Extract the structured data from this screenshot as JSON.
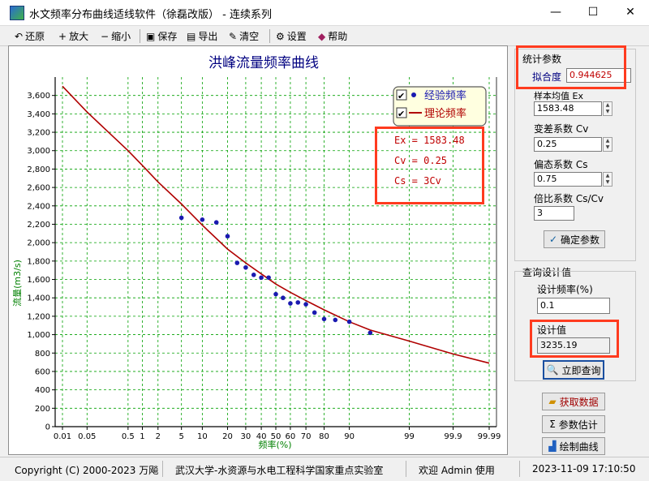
{
  "window": {
    "title": "水文频率分布曲线适线软件（徐磊改版） - 连续系列",
    "minimize": "—",
    "maximize": "☐",
    "close": "✕"
  },
  "toolbar": {
    "restore": {
      "glyph": "↶",
      "label": "还原"
    },
    "zoom_in": {
      "glyph": "+",
      "label": "放大"
    },
    "zoom_out": {
      "glyph": "−",
      "label": "缩小"
    },
    "save": {
      "glyph": "▣",
      "label": "保存"
    },
    "export": {
      "glyph": "▤",
      "label": "导出"
    },
    "clear": {
      "glyph": "✎",
      "label": "清空"
    },
    "settings": {
      "glyph": "⚙",
      "label": "设置"
    },
    "help": {
      "glyph": "◆",
      "label": "帮助"
    }
  },
  "chart_data": {
    "type": "scatter",
    "title": "洪峰流量频率曲线",
    "xlabel": "频率(%)",
    "ylabel": "流量(m3/s)",
    "x_scale": "probability",
    "x_ticks": [
      0.01,
      0.05,
      0.5,
      1,
      2,
      5,
      10,
      20,
      30,
      40,
      50,
      60,
      70,
      80,
      90,
      99,
      99.9,
      99.99
    ],
    "x_tick_labels": [
      "0.01",
      "0.05",
      "0.5",
      "1",
      "2",
      "5",
      "10",
      "20",
      "30",
      "40",
      "50",
      "60",
      "70",
      "80",
      "90",
      "99",
      "99.9",
      "99.99"
    ],
    "ylim": [
      0,
      3800
    ],
    "y_ticks": [
      0,
      200,
      400,
      600,
      800,
      1000,
      1200,
      1400,
      1600,
      1800,
      2000,
      2200,
      2400,
      2600,
      2800,
      3000,
      3200,
      3400,
      3600
    ],
    "y_tick_labels": [
      "0",
      "200",
      "400",
      "600",
      "800",
      "1,000",
      "1,200",
      "1,400",
      "1,600",
      "1,800",
      "2,000",
      "2,200",
      "2,400",
      "2,600",
      "2,800",
      "3,000",
      "3,200",
      "3,400",
      "3,600"
    ],
    "grid": true,
    "series": [
      {
        "name": "经验频率",
        "kind": "points",
        "color": "#1a1ab0",
        "x": [
          5,
          10,
          15,
          20,
          25,
          30,
          35,
          40,
          45,
          50,
          55,
          60,
          65,
          70,
          75,
          80,
          85,
          90,
          95
        ],
        "y": [
          2270,
          2250,
          2220,
          2070,
          1780,
          1730,
          1650,
          1620,
          1620,
          1440,
          1400,
          1340,
          1350,
          1330,
          1240,
          1170,
          1160,
          1140,
          1020
        ]
      },
      {
        "name": "理论频率",
        "kind": "curve",
        "color": "#b00000",
        "x": [
          0.01,
          0.05,
          0.5,
          1,
          2,
          5,
          10,
          20,
          30,
          40,
          50,
          60,
          70,
          80,
          90,
          95,
          99,
          99.9,
          99.99
        ],
        "y": [
          3700,
          3420,
          3000,
          2840,
          2660,
          2420,
          2190,
          1930,
          1780,
          1660,
          1550,
          1460,
          1370,
          1270,
          1140,
          1050,
          930,
          790,
          690
        ]
      }
    ],
    "legend_position": "top-right",
    "annotations": [
      "Ex = 1583.48",
      "Cv = 0.25",
      "Cs = 3Cv"
    ]
  },
  "stats": {
    "group_title": "统计参数",
    "fit_label": "拟合度",
    "fit_value": "0.944625",
    "ex_label": "样本均值 Ex",
    "ex_value": "1583.48",
    "cv_label": "变差系数 Cv",
    "cv_value": "0.25",
    "cs_label": "偏态系数 Cs",
    "cs_value": "0.75",
    "ratio_label": "倍比系数 Cs/Cv",
    "ratio_value": "3",
    "confirm_button": "确定参数"
  },
  "query": {
    "group_title": "查询设计值",
    "freq_label": "设计频率(%)",
    "freq_value": "0.1",
    "design_label": "设计值",
    "design_value": "3235.19",
    "query_button": "立即查询"
  },
  "actions": {
    "fetch_button": "获取数据",
    "estimate_button": "参数估计",
    "draw_button": "绘制曲线"
  },
  "status": {
    "copyright": "Copyright (C) 2000-2023 万飚",
    "org": "武汉大学-水资源与水电工程科学国家重点实验室",
    "welcome": "欢迎 Admin 使用",
    "datetime": "2023-11-09 17:10:50"
  },
  "colors": {
    "highlight_border": "#ff3b1f",
    "grid": "#00a000",
    "axis_text": "#000080",
    "point": "#1a1ab0",
    "curve": "#b00000"
  }
}
